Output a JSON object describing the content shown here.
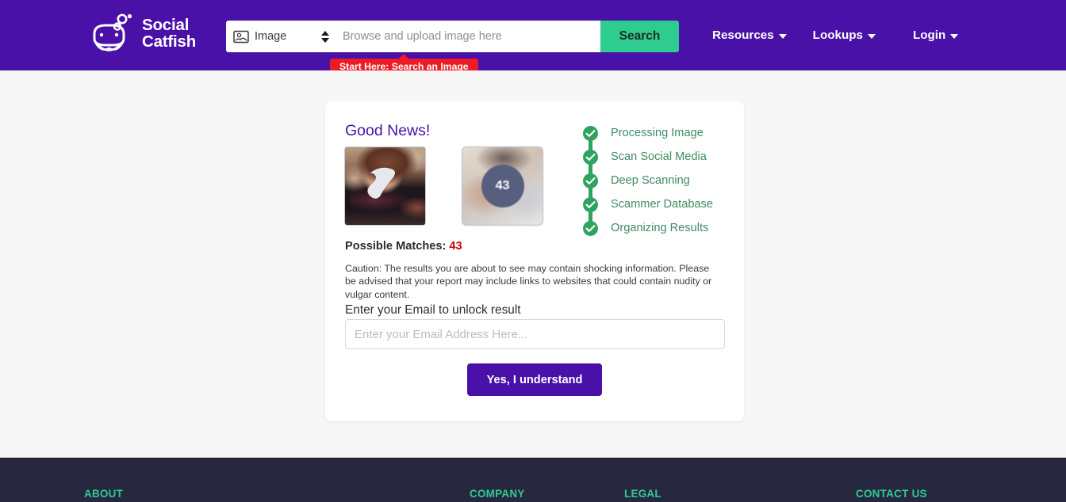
{
  "header": {
    "brand": {
      "line1": "Social",
      "line2": "Catfish",
      "logo_icon": "catfish-logo-icon"
    },
    "search": {
      "type_icon": "image-person-icon",
      "type_label": "Image",
      "spinner_icon": "up-down-spinner-icon",
      "input_value": "",
      "input_placeholder": "Browse and upload image here",
      "button_label": "Search"
    },
    "start_here_badge": "Start Here: Search an Image",
    "nav": [
      {
        "label": "Resources",
        "icon": "chevron-down-icon"
      },
      {
        "label": "Lookups",
        "icon": "chevron-down-icon"
      },
      {
        "label": "Login",
        "icon": "chevron-down-icon"
      }
    ]
  },
  "card": {
    "title": "Good News!",
    "uploaded_thumb_alt": "uploaded-photo-thumbnail",
    "result_thumb_alt": "blurred-result-thumbnail",
    "result_count_badge": "43",
    "matches_label": "Possible Matches:",
    "matches_count": "43",
    "steps": [
      {
        "label": "Processing Image",
        "icon": "check-circle-icon"
      },
      {
        "label": "Scan Social Media",
        "icon": "check-circle-icon"
      },
      {
        "label": "Deep Scanning",
        "icon": "check-circle-icon"
      },
      {
        "label": "Scammer Database",
        "icon": "check-circle-icon"
      },
      {
        "label": "Organizing Results",
        "icon": "check-circle-icon"
      }
    ],
    "caution": "Caution: The results you are about to see may contain shocking information. Please be advised that your report may include links to websites that could contain nudity or vulgar content.",
    "email_label": "Enter your Email to unlock result",
    "email_value": "",
    "email_placeholder": "Enter your Email Address Here...",
    "submit_label": "Yes, I understand"
  },
  "footer": {
    "columns": [
      {
        "heading": "ABOUT"
      },
      {
        "heading": "COMPANY"
      },
      {
        "heading": "LEGAL"
      },
      {
        "heading": "CONTACT US"
      }
    ]
  },
  "colors": {
    "brand_purple": "#4a11a8",
    "accent_green": "#2ecc8f",
    "step_green": "#2fa360",
    "alert_red": "#ed1c24",
    "count_red": "#d00000",
    "footer_dark": "#272840",
    "page_bg": "#f7f7f7"
  }
}
